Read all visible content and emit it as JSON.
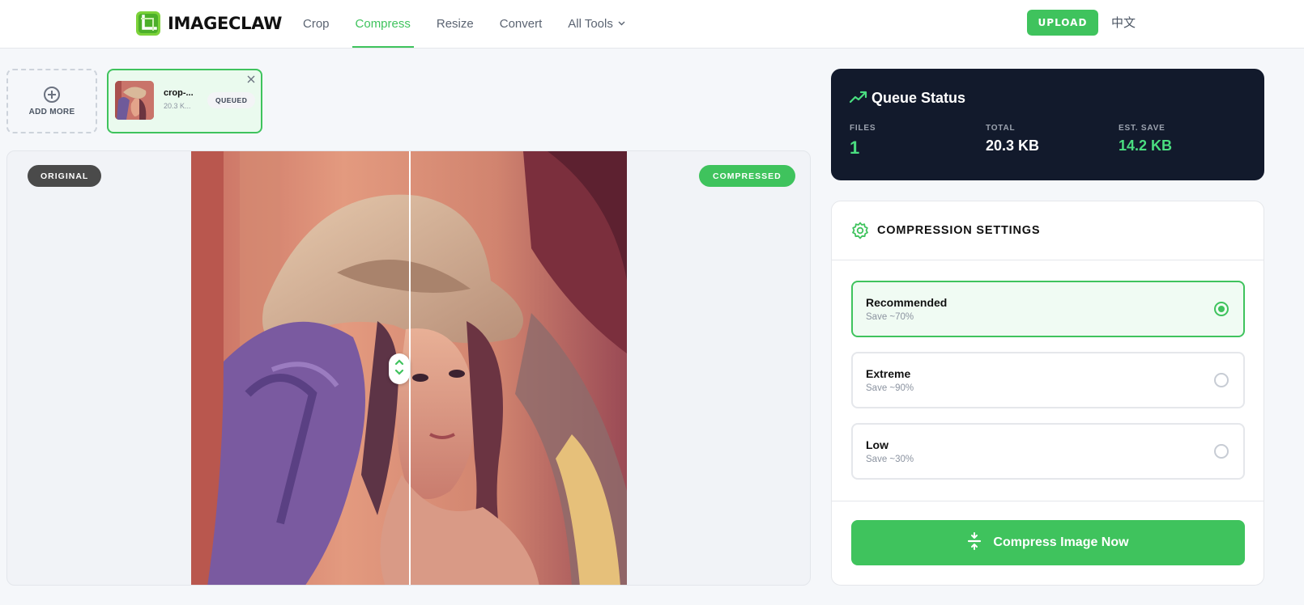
{
  "brand": {
    "name": "IMAGECLAW",
    "accent": "#3fc35d",
    "dark": "#121a2c"
  },
  "nav": {
    "items": [
      {
        "label": "Crop",
        "active": false
      },
      {
        "label": "Compress",
        "active": true
      },
      {
        "label": "Resize",
        "active": false
      },
      {
        "label": "Convert",
        "active": false
      },
      {
        "label": "All Tools",
        "active": false,
        "has_dropdown": true
      }
    ],
    "upload_label": "UPLOAD",
    "language_label": "中文"
  },
  "queue_thumbs": {
    "add_more_label": "ADD MORE",
    "files": [
      {
        "name": "crop-...",
        "size": "20.3 K...",
        "status": "QUEUED"
      }
    ]
  },
  "compare": {
    "original_label": "ORIGINAL",
    "compressed_label": "COMPRESSED",
    "split_position": 0.5
  },
  "queue_status": {
    "title": "Queue Status",
    "files_label": "FILES",
    "files_value": "1",
    "total_label": "TOTAL",
    "total_value": "20.3 KB",
    "save_label": "EST. SAVE",
    "save_value": "14.2 KB"
  },
  "settings": {
    "title": "COMPRESSION SETTINGS",
    "options": [
      {
        "label": "Recommended",
        "sub": "Save ~70%",
        "selected": true
      },
      {
        "label": "Extreme",
        "sub": "Save ~90%",
        "selected": false
      },
      {
        "label": "Low",
        "sub": "Save ~30%",
        "selected": false
      }
    ],
    "action_label": "Compress Image Now"
  }
}
